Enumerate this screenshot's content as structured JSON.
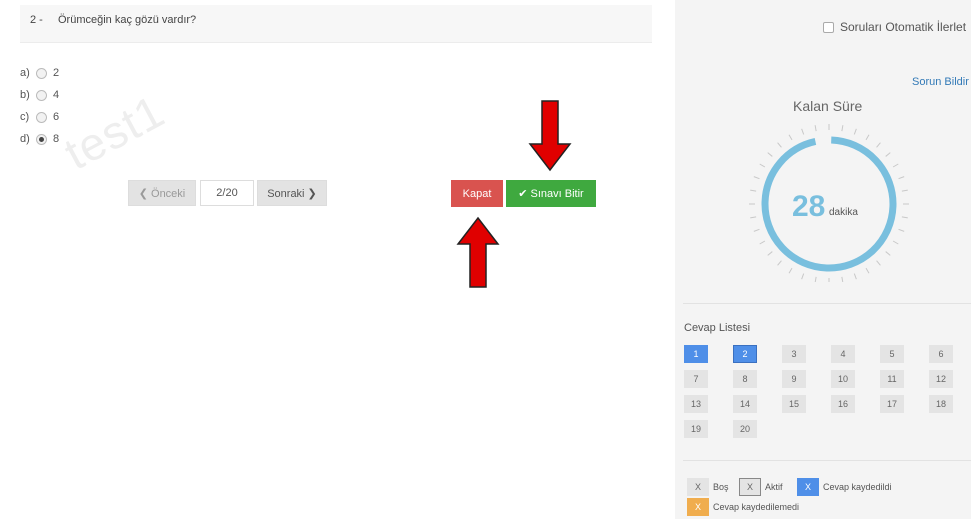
{
  "question": {
    "number": "2 -",
    "text": "Örümceğin kaç gözü vardır?",
    "options": [
      {
        "letter": "a)",
        "value": "2",
        "checked": false
      },
      {
        "letter": "b)",
        "value": "4",
        "checked": false
      },
      {
        "letter": "c)",
        "value": "6",
        "checked": false
      },
      {
        "letter": "d)",
        "value": "8",
        "checked": true
      }
    ]
  },
  "watermark": "test1",
  "pager": {
    "prev_label": "❮ Önceki",
    "indicator": "2/20",
    "next_label": "Sonraki ❯"
  },
  "actions": {
    "close_label": "Kapat",
    "finish_label": "✔ Sınavı Bitir"
  },
  "sidebar": {
    "auto_advance_label": "Soruları Otomatik İlerlet",
    "report_link": "Sorun Bildir",
    "remaining_label": "Kalan Süre",
    "timer_value": "28",
    "timer_unit": "dakika",
    "answer_list_title": "Cevap Listesi",
    "answers": [
      {
        "n": "1",
        "state": "saved"
      },
      {
        "n": "2",
        "state": "saved-active"
      },
      {
        "n": "3",
        "state": "empty"
      },
      {
        "n": "4",
        "state": "empty"
      },
      {
        "n": "5",
        "state": "empty"
      },
      {
        "n": "6",
        "state": "empty"
      },
      {
        "n": "7",
        "state": "empty"
      },
      {
        "n": "8",
        "state": "empty"
      },
      {
        "n": "9",
        "state": "empty"
      },
      {
        "n": "10",
        "state": "empty"
      },
      {
        "n": "11",
        "state": "empty"
      },
      {
        "n": "12",
        "state": "empty"
      },
      {
        "n": "13",
        "state": "empty"
      },
      {
        "n": "14",
        "state": "empty"
      },
      {
        "n": "15",
        "state": "empty"
      },
      {
        "n": "16",
        "state": "empty"
      },
      {
        "n": "17",
        "state": "empty"
      },
      {
        "n": "18",
        "state": "empty"
      },
      {
        "n": "19",
        "state": "empty"
      },
      {
        "n": "20",
        "state": "empty"
      }
    ],
    "legend": {
      "empty_mark": "X",
      "empty_label": "Boş",
      "active_mark": "X",
      "active_label": "Aktif",
      "saved_mark": "X",
      "saved_label": "Cevap kaydedildi",
      "unsaved_mark": "X",
      "unsaved_label": "Cevap kaydedilemedi"
    }
  },
  "colors": {
    "close": "#d9534f",
    "finish": "#3fa93f",
    "saved": "#4f8fe8",
    "unsaved": "#f0ad4e",
    "timer": "#79bfde",
    "arrow": "#e00000"
  }
}
